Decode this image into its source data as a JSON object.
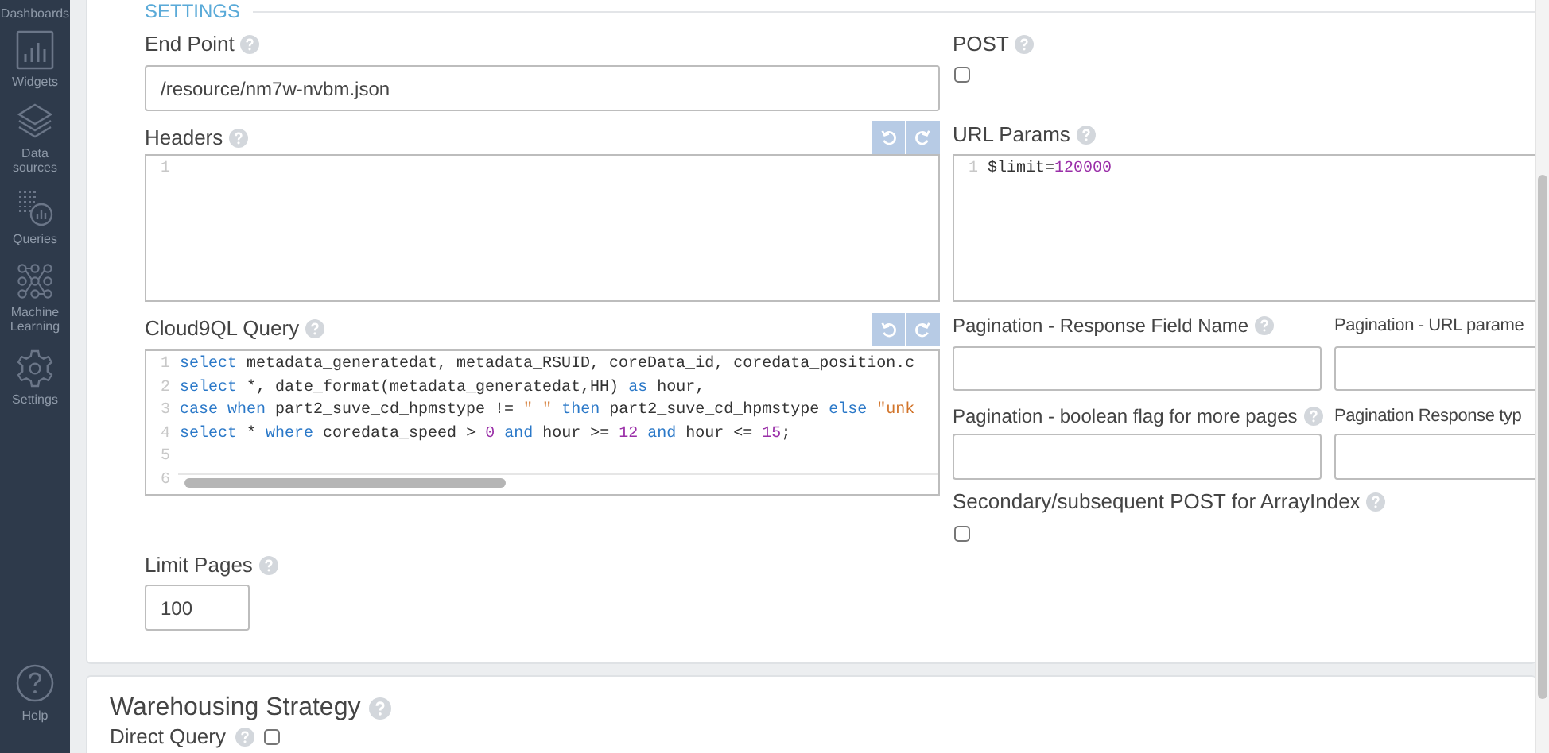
{
  "sidebar": {
    "items": [
      {
        "kind": "dashboards",
        "label": "Dashboards"
      },
      {
        "kind": "widgets",
        "label": "Widgets"
      },
      {
        "kind": "datasources",
        "label": "Data sources"
      },
      {
        "kind": "queries",
        "label": "Queries"
      },
      {
        "kind": "ml",
        "label": "Machine Learning"
      },
      {
        "kind": "settings",
        "label": "Settings"
      }
    ],
    "help": {
      "label": "Help"
    }
  },
  "settings": {
    "heading": "SETTINGS",
    "end_point": {
      "label": "End Point",
      "value": "/resource/nm7w-nvbm.json"
    },
    "post": {
      "label": "POST",
      "checked": false
    },
    "headers": {
      "label": "Headers",
      "lines": [
        {
          "number": "1"
        }
      ]
    },
    "url_params": {
      "label": "URL Params",
      "lines": [
        {
          "number": "1",
          "tokens": [
            {
              "kind": "plain",
              "text": "$limit="
            },
            {
              "kind": "number",
              "text": "120000"
            }
          ]
        }
      ]
    },
    "query": {
      "label": "Cloud9QL Query",
      "lines": [
        {
          "number": "1",
          "tokens": [
            {
              "kind": "keyword",
              "text": "select"
            },
            {
              "kind": "plain",
              "text": " metadata_generatedat, metadata_RSUID, coreData_id, coredata_position.c"
            }
          ]
        },
        {
          "number": "2",
          "tokens": [
            {
              "kind": "keyword",
              "text": "select"
            },
            {
              "kind": "plain",
              "text": " *, date_format(metadata_generatedat,HH) "
            },
            {
              "kind": "keyword",
              "text": "as"
            },
            {
              "kind": "plain",
              "text": " hour,"
            }
          ]
        },
        {
          "number": "3",
          "tokens": [
            {
              "kind": "keyword",
              "text": "case when"
            },
            {
              "kind": "plain",
              "text": " part2_suve_cd_hpmstype != "
            },
            {
              "kind": "string",
              "text": "\" \""
            },
            {
              "kind": "keyword",
              "text": " then"
            },
            {
              "kind": "plain",
              "text": " part2_suve_cd_hpmstype "
            },
            {
              "kind": "keyword",
              "text": "else"
            },
            {
              "kind": "string",
              "text": " \"unk"
            }
          ]
        },
        {
          "number": "4",
          "tokens": [
            {
              "kind": "keyword",
              "text": "select"
            },
            {
              "kind": "plain",
              "text": " * "
            },
            {
              "kind": "keyword",
              "text": "where"
            },
            {
              "kind": "plain",
              "text": " coredata_speed > "
            },
            {
              "kind": "number",
              "text": "0"
            },
            {
              "kind": "keyword",
              "text": " and"
            },
            {
              "kind": "plain",
              "text": " hour >= "
            },
            {
              "kind": "number",
              "text": "12"
            },
            {
              "kind": "keyword",
              "text": " and"
            },
            {
              "kind": "plain",
              "text": " hour <= "
            },
            {
              "kind": "number",
              "text": "15"
            },
            {
              "kind": "plain",
              "text": ";"
            }
          ]
        },
        {
          "number": "5"
        },
        {
          "number": "6"
        }
      ]
    },
    "pagination_fields": [
      {
        "label": "Pagination - Response Field Name",
        "help": true
      },
      {
        "label": "Pagination - URL parame",
        "help": false
      },
      {
        "label": "Pagination - boolean flag for more pages",
        "help": true
      },
      {
        "label": "Pagination Response typ",
        "help": false
      }
    ],
    "secondary_post": {
      "label": "Secondary/subsequent POST for ArrayIndex",
      "checked": false
    },
    "limit_pages": {
      "label": "Limit Pages",
      "value": "100"
    }
  },
  "warehousing": {
    "heading": "Warehousing Strategy",
    "direct_query": {
      "label": "Direct Query",
      "checked": false
    }
  }
}
